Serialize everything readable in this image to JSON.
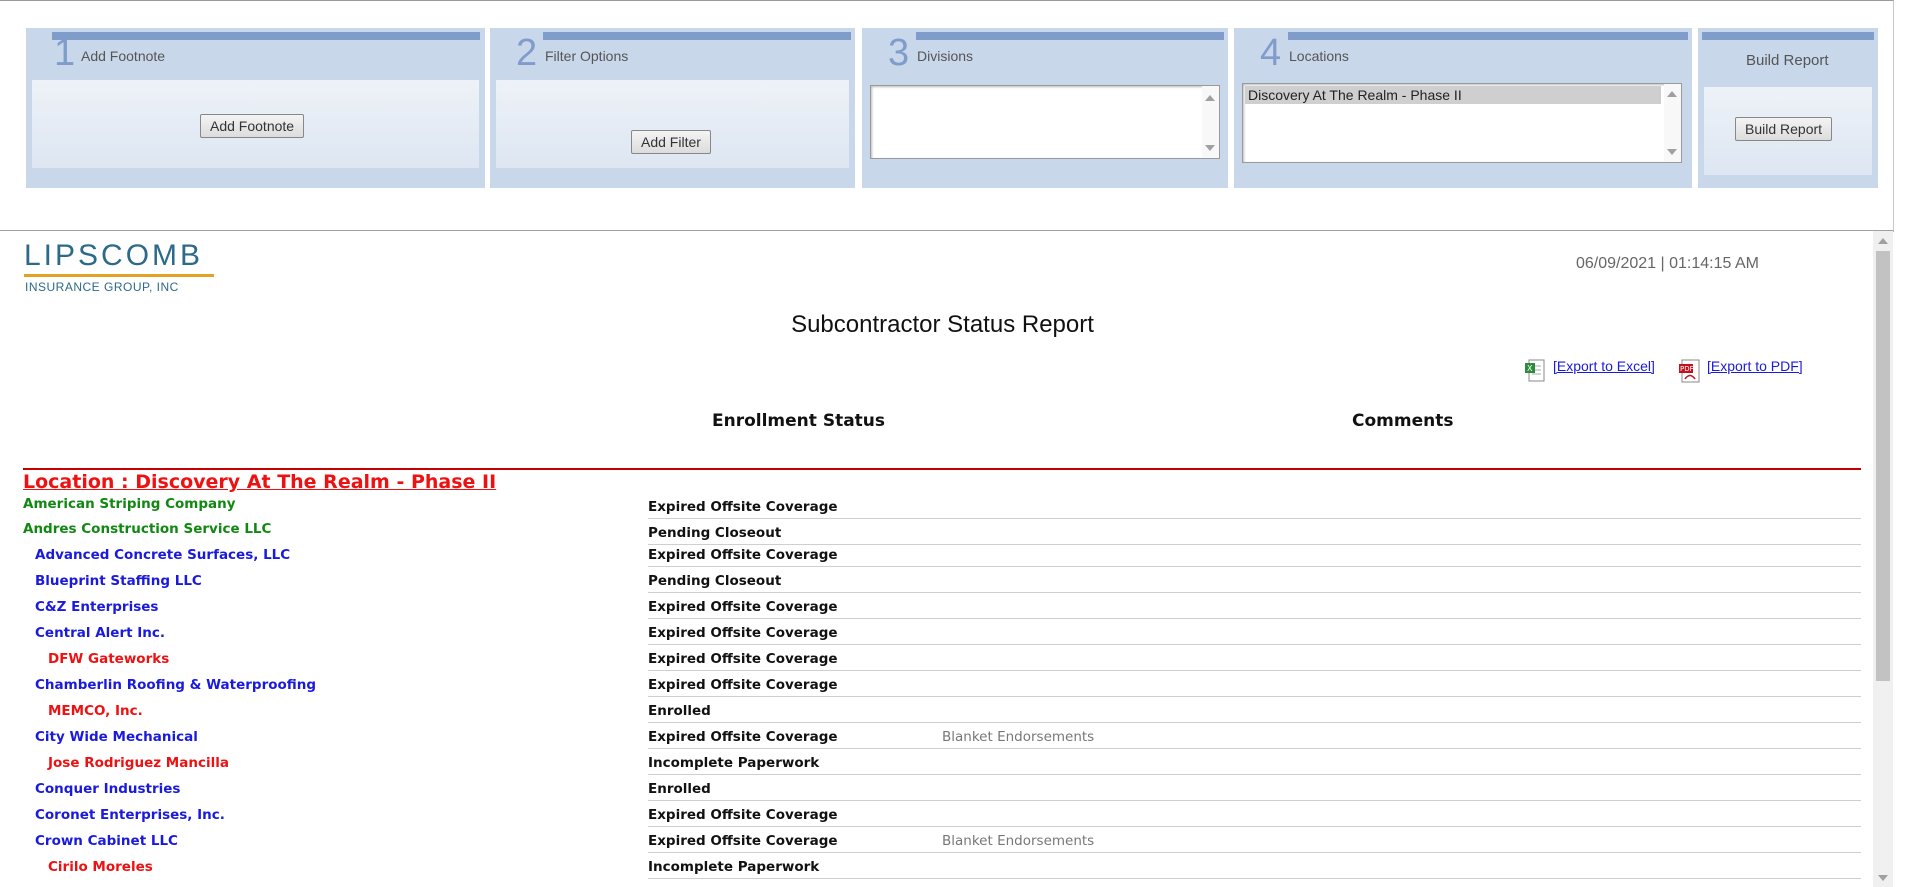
{
  "steps": [
    {
      "num": "1",
      "title": "Add Footnote",
      "button": "Add Footnote"
    },
    {
      "num": "2",
      "title": "Filter Options",
      "button": "Add Filter"
    },
    {
      "num": "3",
      "title": "Divisions",
      "options": []
    },
    {
      "num": "4",
      "title": "Locations",
      "selected": "Discovery At The Realm - Phase II"
    }
  ],
  "build": {
    "title": "Build Report",
    "button": "Build Report"
  },
  "report": {
    "logo_main": "LIPSCOMB",
    "logo_sub": "INSURANCE GROUP, INC",
    "timestamp": "06/09/2021 | 01:14:15 AM",
    "title": "Subcontractor Status Report",
    "export_excel": "[Export to Excel]",
    "export_pdf": "[Export to PDF]",
    "col_status": "Enrollment Status",
    "col_comments": "Comments",
    "location": "Location : Discovery At The Realm - Phase II ",
    "rows": [
      {
        "name": "American Striping Company",
        "level": 0,
        "status": "Expired Offsite Coverage",
        "comment": ""
      },
      {
        "name": "Andres Construction Service LLC",
        "level": 0,
        "status": "Pending Closeout",
        "comment": ""
      },
      {
        "name": "Advanced Concrete Surfaces, LLC",
        "level": 1,
        "status": "Expired Offsite Coverage",
        "comment": ""
      },
      {
        "name": "Blueprint Staffing LLC",
        "level": 1,
        "status": "Pending Closeout",
        "comment": ""
      },
      {
        "name": "C&Z Enterprises",
        "level": 1,
        "status": "Expired Offsite Coverage",
        "comment": ""
      },
      {
        "name": "Central Alert Inc.",
        "level": 1,
        "status": "Expired Offsite Coverage",
        "comment": ""
      },
      {
        "name": "DFW Gateworks",
        "level": 2,
        "status": "Expired Offsite Coverage",
        "comment": ""
      },
      {
        "name": "Chamberlin Roofing & Waterproofing",
        "level": 1,
        "status": "Expired Offsite Coverage",
        "comment": ""
      },
      {
        "name": "MEMCO, Inc.",
        "level": 2,
        "status": "Enrolled",
        "comment": ""
      },
      {
        "name": "City Wide Mechanical",
        "level": 1,
        "status": "Expired Offsite Coverage",
        "comment": "Blanket Endorsements"
      },
      {
        "name": "Jose Rodriguez Mancilla",
        "level": 2,
        "status": "Incomplete Paperwork",
        "comment": ""
      },
      {
        "name": "Conquer Industries",
        "level": 1,
        "status": "Enrolled",
        "comment": ""
      },
      {
        "name": "Coronet Enterprises, Inc.",
        "level": 1,
        "status": "Expired Offsite Coverage",
        "comment": ""
      },
      {
        "name": "Crown Cabinet LLC",
        "level": 1,
        "status": "Expired Offsite Coverage",
        "comment": "Blanket Endorsements"
      },
      {
        "name": "Cirilo Moreles",
        "level": 2,
        "status": "Incomplete Paperwork",
        "comment": ""
      }
    ]
  },
  "colors": {
    "level0": "#118811",
    "level1": "#1a1adf",
    "level2": "#ee1111"
  }
}
